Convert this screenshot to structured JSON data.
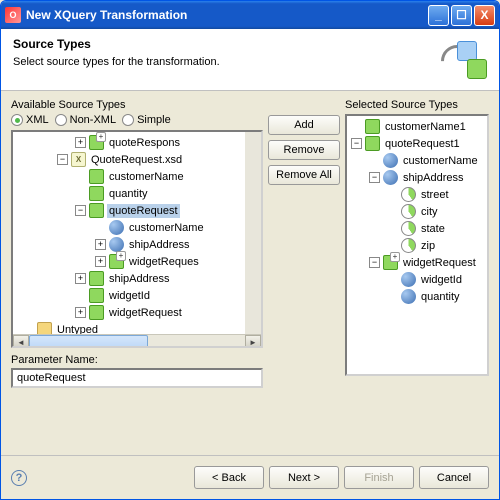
{
  "window": {
    "title": "New XQuery Transformation"
  },
  "banner": {
    "heading": "Source Types",
    "sub": "Select source types for the transformation."
  },
  "labels": {
    "available": "Available Source Types",
    "selected": "Selected Source Types",
    "param": "Parameter Name:"
  },
  "radios": {
    "xml": "XML",
    "nonxml": "Non-XML",
    "simple": "Simple"
  },
  "buttons": {
    "add": "Add",
    "remove": "Remove",
    "removeAll": "Remove All",
    "back": "< Back",
    "next": "Next >",
    "finish": "Finish",
    "cancel": "Cancel"
  },
  "leftTree": {
    "n0": "quoteRespons",
    "n1": "QuoteRequest.xsd",
    "n2": "customerName",
    "n3": "quantity",
    "n4": "quoteRequest",
    "n5": "customerName",
    "n6": "shipAddress",
    "n7": "widgetReques",
    "n8": "shipAddress",
    "n9": "widgetId",
    "n10": "widgetRequest",
    "n11": "Untyped"
  },
  "rightTree": {
    "r0": "customerName1",
    "r1": "quoteRequest1",
    "r2": "customerName",
    "r3": "shipAddress",
    "r4": "street",
    "r5": "city",
    "r6": "state",
    "r7": "zip",
    "r8": "widgetRequest",
    "r9": "widgetId",
    "r10": "quantity"
  },
  "paramValue": "quoteRequest"
}
